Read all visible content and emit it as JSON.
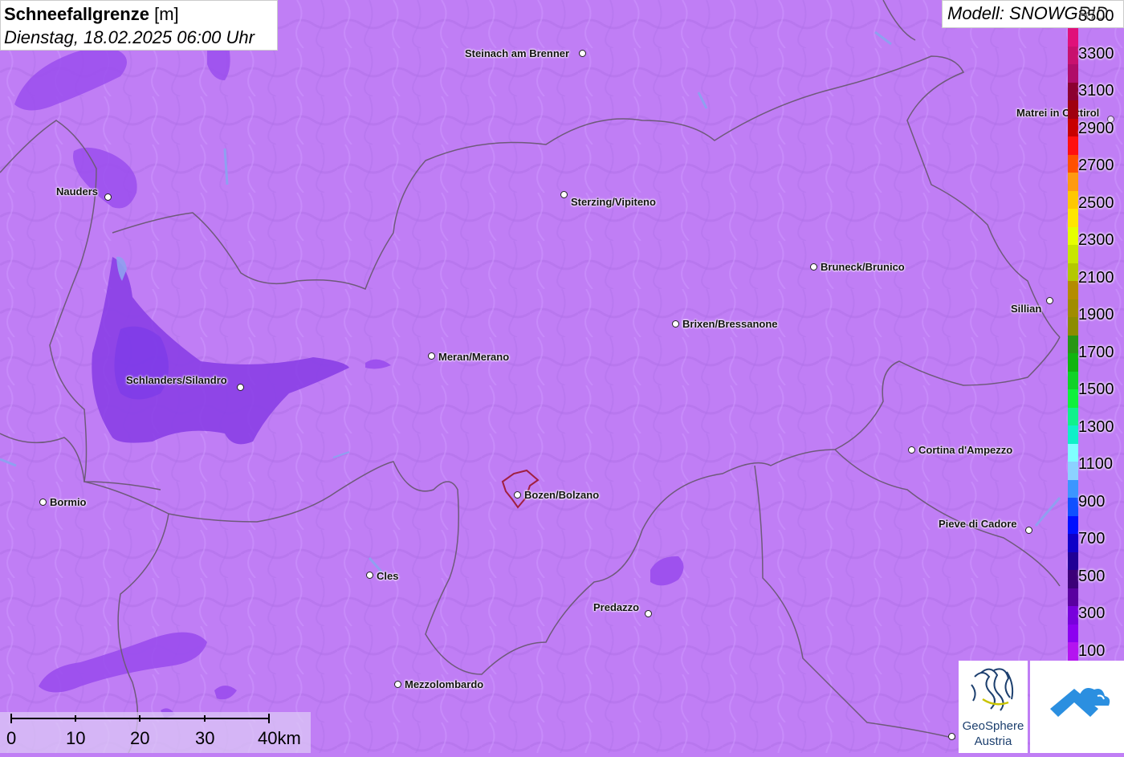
{
  "title": {
    "parameter": "Schneefallgrenze",
    "unit": "[m]",
    "datetime": "Dienstag, 18.02.2025 06:00 Uhr"
  },
  "model": "Modell: SNOWGRID",
  "cities": [
    {
      "name": "Steinach am Brenner",
      "side": "left"
    },
    {
      "name": "Nauders",
      "side": "left"
    },
    {
      "name": "Sterzing/Vipiteno",
      "side": "right"
    },
    {
      "name": "Bruneck/Brunico",
      "side": "right"
    },
    {
      "name": "Sillian",
      "side": "left"
    },
    {
      "name": "Brixen/Bressanone",
      "side": "right"
    },
    {
      "name": "Meran/Merano",
      "side": "right"
    },
    {
      "name": "Schlanders/Silandro",
      "side": "left"
    },
    {
      "name": "Cortina d'Ampezzo",
      "side": "right"
    },
    {
      "name": "Bormio",
      "side": "right"
    },
    {
      "name": "Bozen/Bolzano",
      "side": "right"
    },
    {
      "name": "Pieve di Cadore",
      "side": "left"
    },
    {
      "name": "Cles",
      "side": "right"
    },
    {
      "name": "Predazzo",
      "side": "left"
    },
    {
      "name": "Mezzolombardo",
      "side": "right"
    },
    {
      "name": "Matrei in Osttirol",
      "side": "left"
    }
  ],
  "legend": {
    "labels": [
      "3500",
      "3300",
      "3100",
      "2900",
      "2700",
      "2500",
      "2300",
      "2100",
      "1900",
      "1700",
      "1500",
      "1300",
      "1100",
      "900",
      "700",
      "500",
      "300",
      "100"
    ],
    "colors": [
      "#e0107a",
      "#c8106e",
      "#b00c68",
      "#8c0030",
      "#a00010",
      "#c80000",
      "#ff1010",
      "#ff5000",
      "#ff9a10",
      "#ffc800",
      "#ffe600",
      "#e6ff00",
      "#c8e600",
      "#b4c800",
      "#b48c00",
      "#a08c00",
      "#8c8c00",
      "#289614",
      "#10b410",
      "#10d228",
      "#10f03c",
      "#10f08c",
      "#10f0c8",
      "#80ffff",
      "#8cd2ff",
      "#3c96ff",
      "#1050ff",
      "#0010ff",
      "#1000c8",
      "#200096",
      "#3c0078",
      "#5a00a0",
      "#7800dc",
      "#8c00f0",
      "#b414f0"
    ]
  },
  "scale": {
    "labels": [
      "0",
      "10",
      "20",
      "30",
      "40km"
    ]
  },
  "logo": {
    "name": "GeoSphere",
    "sub": "Austria"
  },
  "colors": {
    "background_snowline": "#c07ef5",
    "low_snowline": "#8a3fe6",
    "border": "#6e5a7a",
    "bozen_outline": "#a02040"
  }
}
